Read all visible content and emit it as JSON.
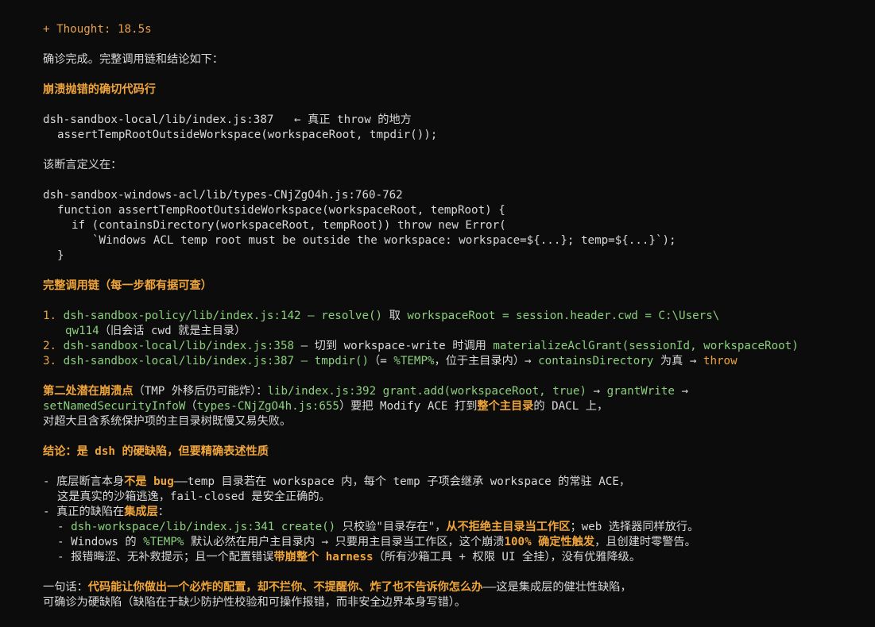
{
  "thought": "+ Thought: 18.5s",
  "intro": "确诊完成。完整调用链和结论如下：",
  "h1": "崩溃抛错的确切代码行",
  "code1": {
    "l1a": "dsh-sandbox-local/lib/index.js:387",
    "l1b": "   ← 真正 throw 的地方",
    "l2": "assertTempRootOutsideWorkspace(workspaceRoot, tmpdir());"
  },
  "def_label": "该断言定义在：",
  "code2": {
    "l1": "dsh-sandbox-windows-acl/lib/types-CNjZgO4h.js:760-762",
    "l2": "function assertTempRootOutsideWorkspace(workspaceRoot, tempRoot) {",
    "l3": "if (containsDirectory(workspaceRoot, tempRoot)) throw new Error(",
    "l4": "`Windows ACL temp root must be outside the workspace: workspace=${...}; temp=${...}`);",
    "l5": "}"
  },
  "h2": "完整调用链（每一步都有据可查）",
  "chain": {
    "n1": "1.",
    "s1a": "dsh-sandbox-policy/lib/index.js:142 — resolve()",
    "s1b": " 取 ",
    "s1c": "workspaceRoot = session.header.cwd = C:\\Users\\",
    "s1d": "qw114",
    "s1e": "（旧会话 cwd 就是主目录）",
    "n2": "2.",
    "s2a": "dsh-sandbox-local/lib/index.js:358",
    "s2b": " — 切到 workspace-write 时调用 ",
    "s2c": "materializeAclGrant(sessionId, workspaceRoot)",
    "n3": "3.",
    "s3a": "dsh-sandbox-local/lib/index.js:387 — tmpdir()",
    "s3b": "（= ",
    "s3c": "%TEMP%",
    "s3d": "，位于主目录内）→ ",
    "s3e": "containsDirectory",
    "s3f": " 为真 → ",
    "s3g": "throw"
  },
  "second": {
    "a": "第二处潜在崩溃点",
    "b": "（TMP 外移后仍可能炸）：",
    "c": "lib/index.js:392 grant.add(workspaceRoot, true)",
    "d": " → ",
    "e": "grantWrite",
    "f": " →",
    "g": "setNamedSecurityInfoW",
    "h": "（",
    "i": "types-CNjZgO4h.js:655",
    "j": "）要把 Modify ACE 打到",
    "k": "整个主目录",
    "l": "的 DACL 上，",
    "m": "对超大且含系统保护项的主目录树既慢又易失败。"
  },
  "h3": "结论：是 dsh 的硬缺陷，但要精确表述性质",
  "concl": {
    "p1a": "- 底层断言本身",
    "p1b": "不是 bug",
    "p1c": "——temp 目录若在 workspace 内，每个 temp 子项会继承 workspace 的常驻 ACE，",
    "p1d": "这是真实的沙箱逃逸，fail-closed 是安全正确的。",
    "p2a": "- 真正的缺陷在",
    "p2b": "集成层",
    "p2c": "：",
    "s1a": "- ",
    "s1b": "dsh-workspace/lib/index.js:341 create()",
    "s1c": " 只校验\"目录存在\"，",
    "s1d": "从不拒绝主目录当工作区",
    "s1e": "；web 选择器同样放行。",
    "s2a": "- Windows 的 ",
    "s2b": "%TEMP%",
    "s2c": " 默认必然在用户主目录内 → 只要用主目录当工作区，这个崩溃",
    "s2d": "100% 确定性触发",
    "s2e": "，且创建时零警告。",
    "s3a": "- 报错晦涩、无补救提示；且一个配置错误",
    "s3b": "带崩整个 harness",
    "s3c": "（所有沙箱工具 + 权限 UI 全挂），没有优雅降级。"
  },
  "summary": {
    "a": "一句话：",
    "b": "代码能让你做出一个必炸的配置，却不拦你、不提醒你、炸了也不告诉你怎么办",
    "c": "——这是集成层的健壮性缺陷，",
    "d": "可确诊为硬缺陷（缺陷在于缺少防护性校验和可操作报错，而非安全边界本身写错）。"
  },
  "colors": {
    "background": "#0c0c0c",
    "text": "#d9d9d9",
    "accent_orange": "#f0a53a",
    "code_green": "#8ccf7e"
  }
}
